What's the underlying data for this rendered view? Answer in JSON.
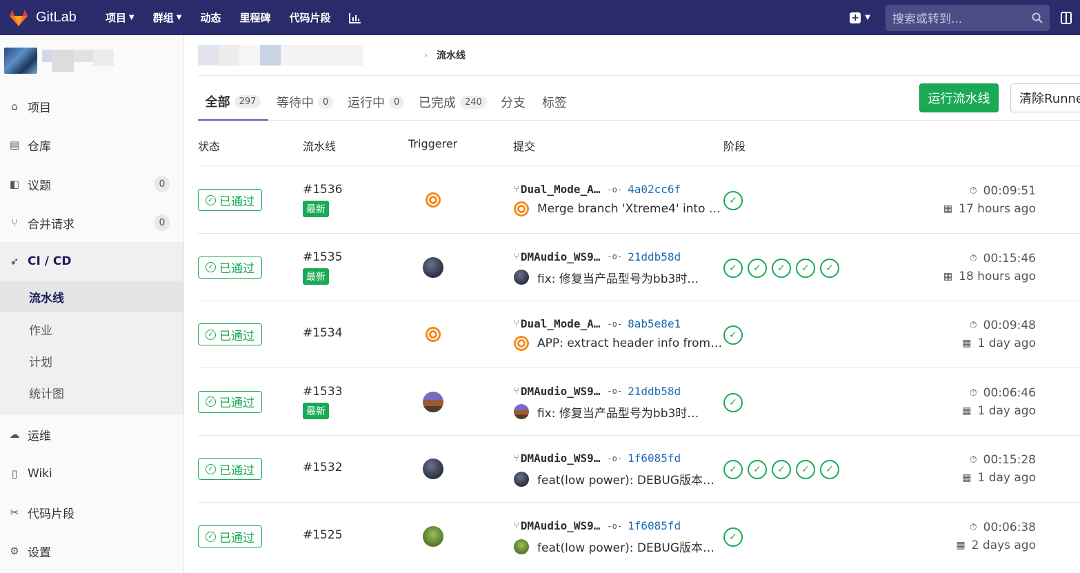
{
  "navbar": {
    "brand": "GitLab",
    "links": [
      "项目",
      "群组",
      "动态",
      "里程碑",
      "代码片段"
    ],
    "search_placeholder": "搜索或转到..."
  },
  "sidebar": {
    "items": [
      {
        "label": "项目"
      },
      {
        "label": "仓库"
      },
      {
        "label": "议题",
        "count": "0"
      },
      {
        "label": "合并请求",
        "count": "0"
      },
      {
        "label": "CI / CD"
      },
      {
        "label": "运维"
      },
      {
        "label": "Wiki"
      },
      {
        "label": "代码片段"
      },
      {
        "label": "设置"
      }
    ],
    "cicd_sub": [
      "流水线",
      "作业",
      "计划",
      "统计图"
    ]
  },
  "breadcrumb": {
    "current": "流水线"
  },
  "tabs": [
    {
      "label": "全部",
      "count": "297"
    },
    {
      "label": "等待中",
      "count": "0"
    },
    {
      "label": "运行中",
      "count": "0"
    },
    {
      "label": "已完成",
      "count": "240"
    },
    {
      "label": "分支"
    },
    {
      "label": "标签"
    }
  ],
  "buttons": {
    "run": "运行流水线",
    "clear": "清除Runner"
  },
  "table": {
    "headers": [
      "状态",
      "流水线",
      "Triggerer",
      "提交",
      "阶段"
    ],
    "status_label": "已通过",
    "latest_label": "最新",
    "rows": [
      {
        "id": "#1536",
        "latest": true,
        "ref": "Dual_Mode_A…",
        "sha": "4a02cc6f",
        "msg": "Merge branch 'Xtreme4' into …",
        "stages": 1,
        "duration": "00:09:51",
        "ago": "17 hours ago",
        "avatar": "orange"
      },
      {
        "id": "#1535",
        "latest": true,
        "ref": "DMAudio_WS9…",
        "sha": "21ddb58d",
        "msg": "fix: 修复当产品型号为bb3时…",
        "stages": 5,
        "duration": "00:15:46",
        "ago": "18 hours ago",
        "avatar": "dark"
      },
      {
        "id": "#1534",
        "latest": false,
        "ref": "Dual_Mode_A…",
        "sha": "8ab5e8e1",
        "msg": "APP: extract header info from…",
        "stages": 1,
        "duration": "00:09:48",
        "ago": "1 day ago",
        "avatar": "orange"
      },
      {
        "id": "#1533",
        "latest": true,
        "ref": "DMAudio_WS9…",
        "sha": "21ddb58d",
        "msg": "fix: 修复当产品型号为bb3时…",
        "stages": 1,
        "duration": "00:06:46",
        "ago": "1 day ago",
        "avatar": "mount"
      },
      {
        "id": "#1532",
        "latest": false,
        "ref": "DMAudio_WS9…",
        "sha": "1f6085fd",
        "msg": "feat(low power): DEBUG版本…",
        "stages": 5,
        "duration": "00:15:28",
        "ago": "1 day ago",
        "avatar": "dark"
      },
      {
        "id": "#1525",
        "latest": false,
        "ref": "DMAudio_WS9…",
        "sha": "1f6085fd",
        "msg": "feat(low power): DEBUG版本…",
        "stages": 1,
        "duration": "00:06:38",
        "ago": "2 days ago",
        "avatar": "green"
      }
    ]
  },
  "colors": {
    "navbar": "#2a2b6a",
    "success": "#1aaa55",
    "link": "#1b69b6",
    "tab_active": "#6b4fbb"
  }
}
